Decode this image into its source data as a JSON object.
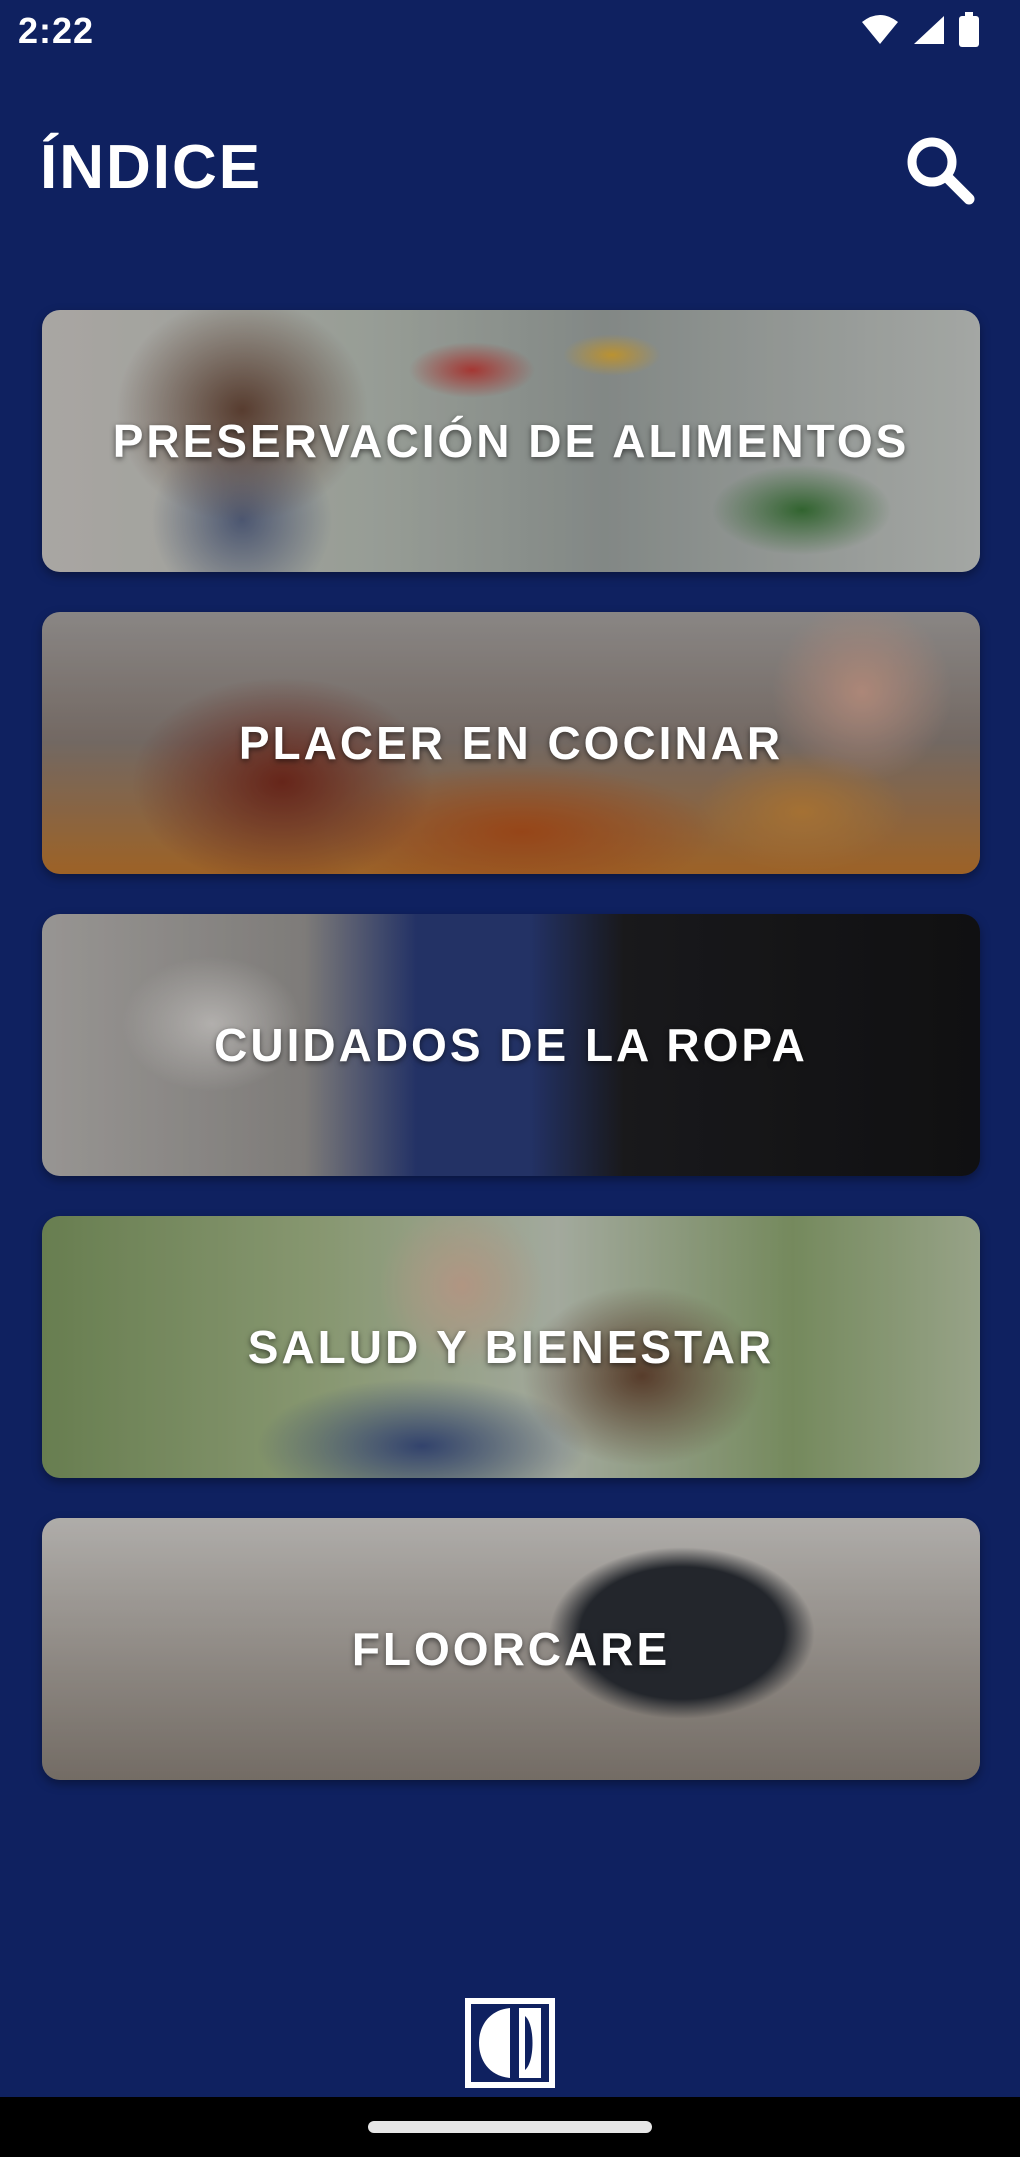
{
  "status_bar": {
    "time": "2:22",
    "icons": [
      "wifi-icon",
      "signal-icon",
      "battery-icon"
    ]
  },
  "header": {
    "title": "ÍNDICE",
    "search_icon": "search-icon"
  },
  "categories": [
    {
      "label": "PRESERVACIÓN DE ALIMENTOS"
    },
    {
      "label": "PLACER EN COCINAR"
    },
    {
      "label": "CUIDADOS DE LA ROPA"
    },
    {
      "label": "SALUD Y BIENESTAR"
    },
    {
      "label": "FLOORCARE"
    }
  ],
  "footer": {
    "logo_icon": "electrolux-logo-icon"
  },
  "colors": {
    "background": "#0f2160",
    "text": "#ffffff"
  }
}
